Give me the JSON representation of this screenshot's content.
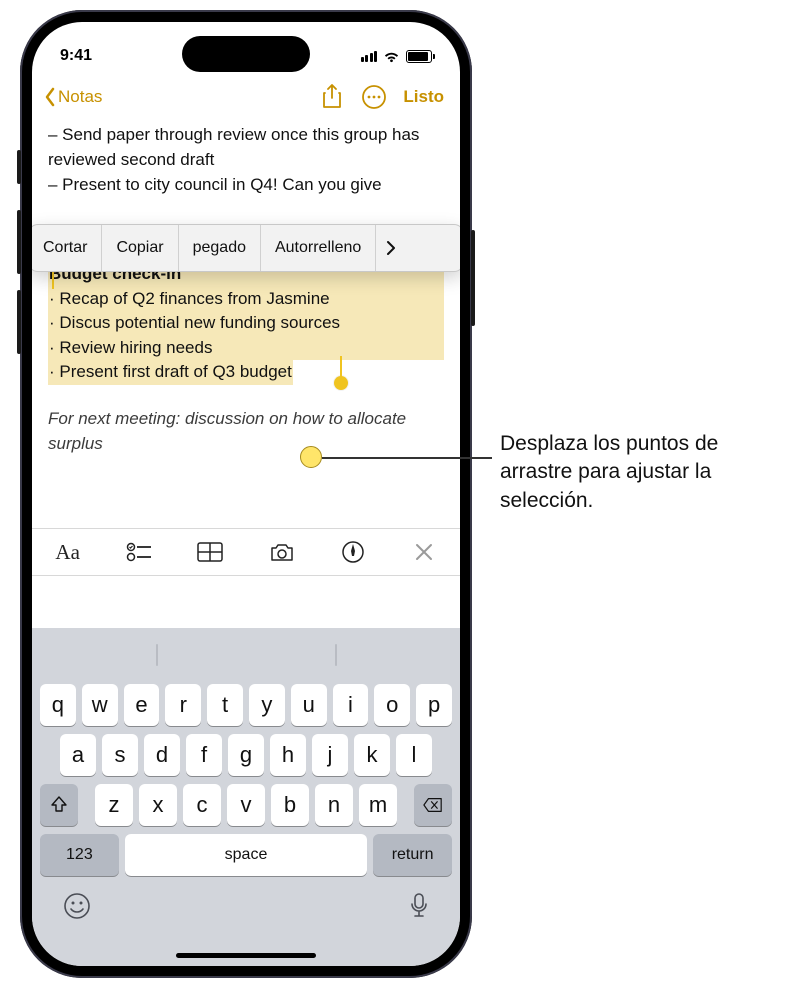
{
  "status": {
    "time": "9:41"
  },
  "nav": {
    "back": "Notas",
    "done": "Listo"
  },
  "content": {
    "line1": "– Send paper through review once this group has reviewed second draft",
    "line2": "– Present to city council in Q4! Can you give",
    "selection": {
      "title": "Budget check-in",
      "b1": "· Recap of Q2 finances from Jasmine",
      "b2": "· Discus potential new funding sources",
      "b3": "· Review hiring needs",
      "b4": "· Present first draft of Q3 budget"
    },
    "footer": "For next meeting: discussion on how to allocate surplus"
  },
  "editMenu": {
    "cut": "Cortar",
    "copy": "Copiar",
    "paste": "pegado",
    "autofill": "Autorrelleno"
  },
  "keyboard": {
    "row1": [
      "q",
      "w",
      "e",
      "r",
      "t",
      "y",
      "u",
      "i",
      "o",
      "p"
    ],
    "row2": [
      "a",
      "s",
      "d",
      "f",
      "g",
      "h",
      "j",
      "k",
      "l"
    ],
    "row3": [
      "z",
      "x",
      "c",
      "v",
      "b",
      "n",
      "m"
    ],
    "num": "123",
    "space": "space",
    "return": "return"
  },
  "annotation": "Desplaza los puntos de arrastre para ajustar la selección."
}
